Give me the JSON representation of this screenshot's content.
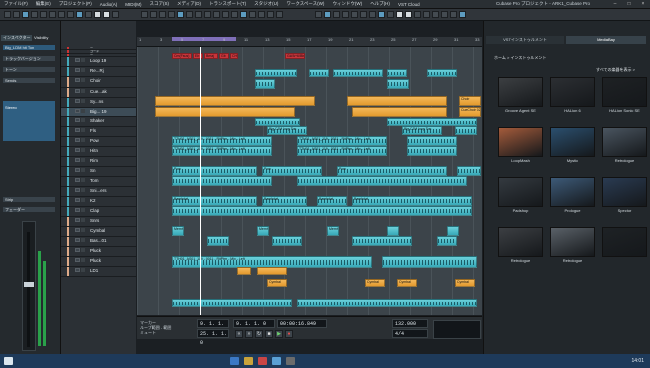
{
  "menu": [
    "ファイル(F)",
    "編集(E)",
    "プロジェクト(P)",
    "Audio(A)",
    "MIDI(M)",
    "スコア(S)",
    "メディア(D)",
    "トランスポート(T)",
    "スタジオ(U)",
    "ワークスペース(W)",
    "ウィンドウ(W)",
    "ヘルプ(H)",
    "VST Cloud"
  ],
  "window_title": "Cubase Pro プロジェクト - ARK1_Cubase Pro",
  "inspector": {
    "tabs": [
      "インスペクター",
      "Visibility"
    ],
    "track_name": "Big_LDM hit Ton",
    "rows": [
      "トラックバージョン",
      "トーン",
      "Sends"
    ],
    "selected": "Stereo",
    "lower_rows": [
      "Strip",
      "フェーダー"
    ]
  },
  "tracks": [
    {
      "name": "ー",
      "color": "#c33"
    },
    {
      "name": "コード",
      "color": "#c33"
    },
    {
      "name": "ー",
      "color": "#c33"
    },
    {
      "name": "Loop 19",
      "color": "#4ab"
    },
    {
      "name": "Re...Rj",
      "color": "#4ab"
    },
    {
      "name": "Choir",
      "color": "#da8"
    },
    {
      "name": "Cue...ak",
      "color": "#da8"
    },
    {
      "name": "Sy...ns",
      "color": "#4ab"
    },
    {
      "name": "Big... 19",
      "color": "#4ab"
    },
    {
      "name": "Shaker",
      "color": "#4ab"
    },
    {
      "name": "Fls",
      "color": "#4ab"
    },
    {
      "name": "Pow",
      "color": "#4ab"
    },
    {
      "name": "Hitn",
      "color": "#4ab"
    },
    {
      "name": "Rim",
      "color": "#4ab"
    },
    {
      "name": "Sn",
      "color": "#4ab"
    },
    {
      "name": "Tom",
      "color": "#4ab"
    },
    {
      "name": "Sni...ers",
      "color": "#4ab"
    },
    {
      "name": "K2",
      "color": "#4ab"
    },
    {
      "name": "Clap",
      "color": "#4ab"
    },
    {
      "name": "Snrs",
      "color": "#da8"
    },
    {
      "name": "Cymbal",
      "color": "#da8"
    },
    {
      "name": "Bas...01",
      "color": "#da8"
    },
    {
      "name": "Pluck",
      "color": "#da8"
    },
    {
      "name": "Pluck",
      "color": "#da8"
    },
    {
      "name": "LD1",
      "color": "#da8"
    }
  ],
  "ruler_ticks": [
    "1",
    "3",
    "5",
    "7",
    "9",
    "11",
    "13",
    "15",
    "17",
    "19",
    "21",
    "23",
    "25",
    "27",
    "29",
    "31",
    "33"
  ],
  "clip_labels": {
    "chord1": "Cm(Fsus)",
    "chord2": "Eb",
    "chord3": "Bmaj",
    "chord4": "Gb",
    "chord5": "CH",
    "chord6": "G#/A+6/Bb",
    "loop": "Loop 19",
    "bigclip": "Big CJM loop Ton",
    "choir": "Choir",
    "cueclip": "CueChoir 02",
    "shaker": "TTH01_AS01_119 - 0011 - RitPtrn - Mix - Left",
    "pow": "Pow",
    "mhit": "MemHit",
    "snare": "Bambdat",
    "tom": "Tom",
    "cymbal": "Cymbal"
  },
  "transport": {
    "left_locator": "9. 1. 1. 0",
    "right_locator": "25. 1. 1. 0",
    "position": "9. 1. 1. 0",
    "time": "00:00:16.849",
    "tempo": "132.000",
    "signature": "4/4",
    "markers": [
      "マーカー",
      "ループ範囲 - 範囲",
      "ミュート"
    ]
  },
  "rightzone": {
    "tabs": [
      "VSTインストゥルメント",
      "MediaBay"
    ],
    "crumb": "ホーム > インストゥルメント",
    "all_label": "すべての楽器を表示 >",
    "instruments": [
      "Groove Agent SE",
      "HALion 6",
      "HALion Sonic SE",
      "LoopMash",
      "Mystic",
      "Retrologue",
      "Padshop",
      "Prologue",
      "Spector",
      "Retrologue",
      "Retrologue",
      ""
    ]
  },
  "clock": "14:01"
}
